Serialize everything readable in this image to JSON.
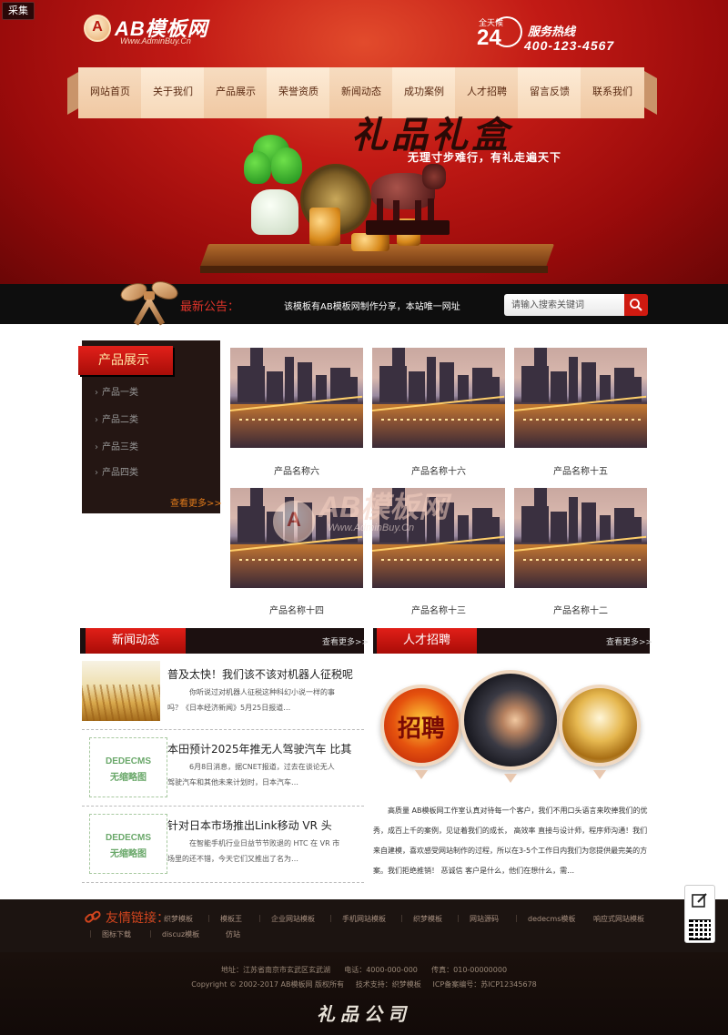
{
  "header": {
    "collect_label": "采集",
    "logo_mark": "A",
    "logo_text": "AB模板网",
    "logo_url": "Www.AdminBuy.Cn",
    "hotline_small": "全天候",
    "hotline_24": "24",
    "hotline_label": "服务热线",
    "hotline_number": "400-123-4567"
  },
  "nav": {
    "items": [
      "网站首页",
      "关于我们",
      "产品展示",
      "荣誉资质",
      "新闻动态",
      "成功案例",
      "人才招聘",
      "留言反馈",
      "联系我们"
    ]
  },
  "banner": {
    "title": "礼品礼盒",
    "slogan": "无理寸步难行，有礼走遍天下"
  },
  "notice": {
    "label": "最新公告：",
    "text": "该模板有AB模板网制作分享，本站唯一网址",
    "search_placeholder": "请输入搜索关键词"
  },
  "sidebar": {
    "title": "产品展示",
    "items": [
      "产品一类",
      "产品二类",
      "产品三类",
      "产品四类"
    ],
    "more": "查看更多>>"
  },
  "products": [
    {
      "name": "产品名称六"
    },
    {
      "name": "产品名称十六"
    },
    {
      "name": "产品名称十五"
    },
    {
      "name": "产品名称十四"
    },
    {
      "name": "产品名称十三"
    },
    {
      "name": "产品名称十二"
    }
  ],
  "watermark": {
    "mark": "A",
    "text": "AB模板网",
    "url": "Www.AdminBuy.Cn"
  },
  "news": {
    "title": "新闻动态",
    "more": "查看更多>>",
    "items": [
      {
        "title": "普及太快！我们该不该对机器人征税呢",
        "desc": "你听说过对机器人征税这种科幻小说一样的事吗？《日本经济新闻》5月25日报道…",
        "thumb": "wheat"
      },
      {
        "title": "本田预计2025年推无人驾驶汽车 比其",
        "desc": "6月8日消息，据CNET报道，过去在谈论无人驾驶汽车和其他未来计划时，日本汽车…",
        "thumb": "none"
      },
      {
        "title": "针对日本市场推出Link移动 VR 头",
        "desc": "在智能手机行业日益节节败退的 HTC 在 VR 市场里的还不错，今天它们又推出了名为…",
        "thumb": "none"
      }
    ],
    "no_image_top": "DEDECMS",
    "no_image_bottom": "无缩略图"
  },
  "recruit": {
    "title": "人才招聘",
    "more": "查看更多>>",
    "badge_text": "招聘",
    "text": "高质量 AB模板网工作室认真对待每一个客户，我们不用口头语言来吹捧我们的优秀，成百上千的案例，见证着我们的成长， 高效率 直接与设计师，程序师沟通！我们来自建模，喜欢感受网站制作的过程，所以在3-5个工作日内我们为您提供最完美的方案。我们拒绝推销！ 恶诚信 客户是什么，他们在想什么，需…"
  },
  "footer": {
    "links_title": "友情链接：",
    "links": [
      "织梦模板",
      "模板王",
      "企业网站模板",
      "手机网站模板",
      "织梦模板",
      "网站源码",
      "dedecms模板",
      "响应式网站模板",
      "图标下载",
      "discuz模板",
      "仿站"
    ],
    "address": "地址：江苏省南京市玄武区玄武湖",
    "phone": "电话：4000-000-000",
    "fax": "传真：010-00000000",
    "copyright": "Copyright © 2002-2017 AB模板网 版权所有",
    "support": "技术支持：织梦模板",
    "icp": "ICP备案编号：苏ICP12345678",
    "brand": "礼品公司"
  },
  "colors": {
    "brand_red": "#c21a15",
    "accent_orange": "#e07a1a",
    "dark_bg": "#1c1411"
  }
}
